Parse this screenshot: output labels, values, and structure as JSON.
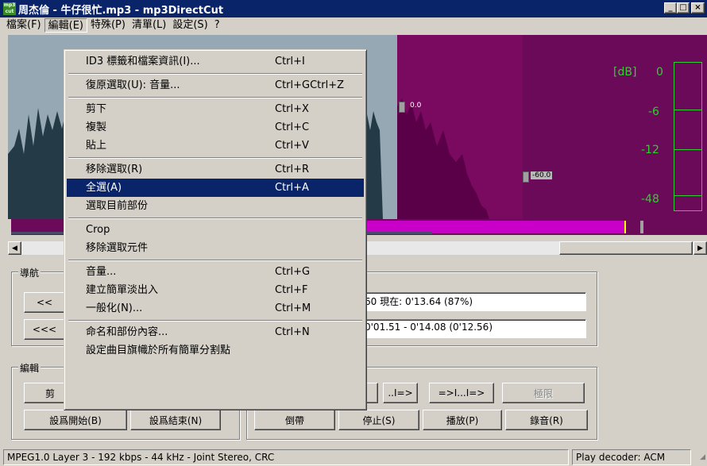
{
  "window": {
    "title": "周杰倫 - 牛仔很忙.mp3 - mp3DirectCut",
    "app_icon_text": "mp3 cut"
  },
  "title_buttons": {
    "minimize": "_",
    "maximize": "□",
    "close": "×"
  },
  "menubar": [
    {
      "label": "檔案(F)"
    },
    {
      "label": "編輯(E)"
    },
    {
      "label": "特殊(P)"
    },
    {
      "label": "清單(L)"
    },
    {
      "label": "設定(S)"
    },
    {
      "label": "?"
    }
  ],
  "edit_menu": {
    "groups": [
      [
        {
          "label": "ID3 標籤和檔案資訊(I)...",
          "shortcut": "Ctrl+I"
        }
      ],
      [
        {
          "label": "復原選取(U): 音量...",
          "shortcut": "Ctrl+GCtrl+Z"
        }
      ],
      [
        {
          "label": "剪下",
          "shortcut": "Ctrl+X"
        },
        {
          "label": "複製",
          "shortcut": "Ctrl+C"
        },
        {
          "label": "貼上",
          "shortcut": "Ctrl+V"
        }
      ],
      [
        {
          "label": "移除選取(R)",
          "shortcut": "Ctrl+R"
        },
        {
          "label": "全選(A)",
          "shortcut": "Ctrl+A",
          "highlighted": true
        },
        {
          "label": "選取目前部份",
          "shortcut": ""
        }
      ],
      [
        {
          "label": "Crop",
          "shortcut": ""
        },
        {
          "label": "移除選取元件",
          "shortcut": ""
        }
      ],
      [
        {
          "label": "音量...",
          "shortcut": "Ctrl+G"
        },
        {
          "label": "建立簡單淡出入",
          "shortcut": "Ctrl+F"
        },
        {
          "label": "一般化(N)...",
          "shortcut": "Ctrl+M"
        }
      ],
      [
        {
          "label": "命名和部份內容...",
          "shortcut": "Ctrl+N"
        },
        {
          "label": "設定曲目旗幟於所有簡單分割點",
          "shortcut": ""
        }
      ]
    ]
  },
  "waveform": {
    "markers": {
      "marker1": "0.0",
      "marker2": "-60.0"
    },
    "db_meter": {
      "unit": "[dB]",
      "levels": [
        "0",
        "-6",
        "-12",
        "-48"
      ]
    },
    "colors": {
      "unselected_bg": "#97a8b5",
      "unselected_wave": "#243a46",
      "selected_bg": "#7a0a60",
      "selected_wave": "#5a0048",
      "meter_bg": "#6a0a58",
      "meter_text": "#2fd02f",
      "ruler_magenta": "#c800c8"
    }
  },
  "navigation": {
    "label": "導航",
    "btn_prev": "<<",
    "btn_prev2": "<<<",
    "position_text": "60  現在: 0'13.64  (87%)",
    "selection_text": "0'01.51 - 0'14.08 (0'12.56)"
  },
  "edit_group": {
    "label": "編輯",
    "cut_partial": "剪",
    "set_begin": "設爲開始(B)",
    "set_end": "設爲結束(N)"
  },
  "playback": {
    "btn_bar": "|",
    "btn_next_cue": "..I=>",
    "btn_sel": "=>I...I=>",
    "btn_limit": "極限",
    "btn_rewind": "倒帶",
    "btn_stop": "停止(S)",
    "btn_play": "播放(P)",
    "btn_record": "錄音(R)"
  },
  "status": {
    "info": "MPEG1.0 Layer 3 - 192 kbps - 44 kHz - Joint Stereo, CRC",
    "decoder": "Play decoder: ACM"
  }
}
